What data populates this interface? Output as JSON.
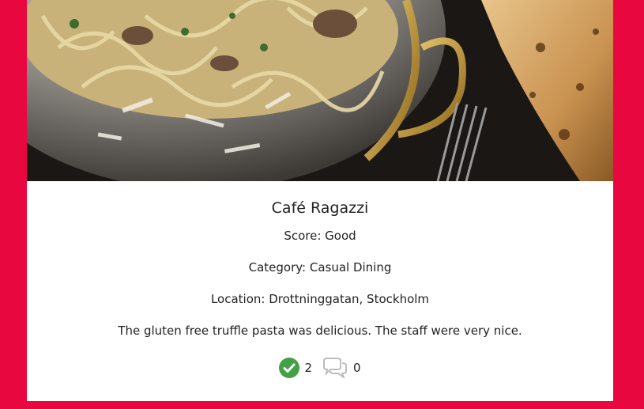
{
  "review": {
    "title": "Café Ragazzi",
    "score": "Score: Good",
    "category": "Category: Casual Dining",
    "location": "Location: Drottninggatan, Stockholm",
    "body": "The gluten free truffle pasta was delicious. The staff were very nice."
  },
  "actions": {
    "approve_icon": "check-circle-icon",
    "approve_count": "2",
    "comment_icon": "comments-icon",
    "comment_count": "0"
  },
  "colors": {
    "background": "#E8083F",
    "card": "#FFFFFF",
    "approve": "#43A047",
    "comment_icon": "#BDBDBD"
  }
}
